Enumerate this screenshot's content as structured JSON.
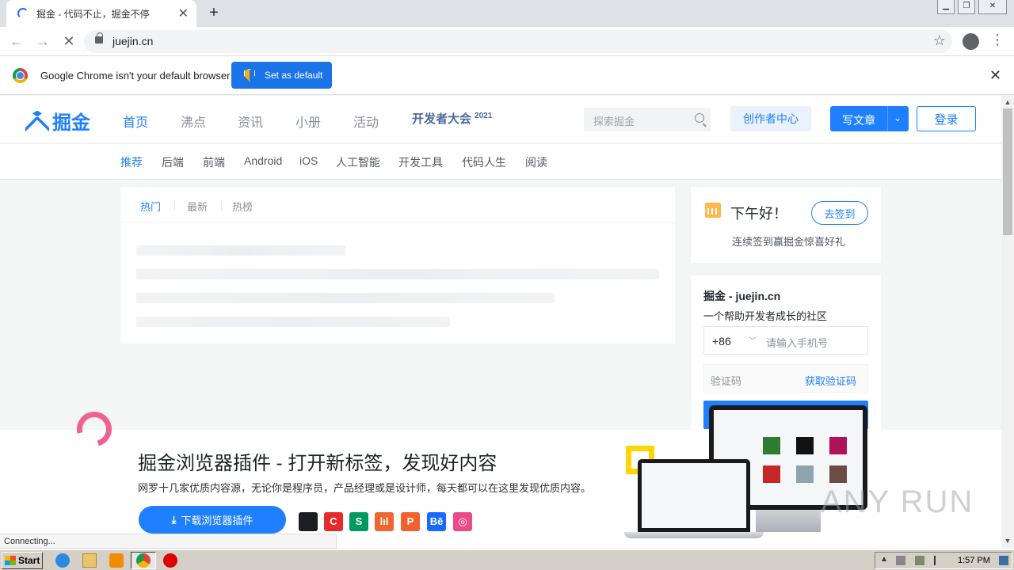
{
  "browser": {
    "tab_title": "掘金 - 代码不止，掘金不停",
    "url": "juejin.cn",
    "infobar_message": "Google Chrome isn't your default browser",
    "set_default_label": "Set as default",
    "status_text": "Connecting..."
  },
  "header": {
    "logo_text": "掘金",
    "nav": [
      "首页",
      "沸点",
      "资讯",
      "小册",
      "活动"
    ],
    "conference_label": "开发者大会",
    "conference_year": "2021",
    "search_placeholder": "探索掘金",
    "creator_label": "创作者中心",
    "write_label": "写文章",
    "login_label": "登录"
  },
  "categories": [
    "推荐",
    "后端",
    "前端",
    "Android",
    "iOS",
    "人工智能",
    "开发工具",
    "代码人生",
    "阅读"
  ],
  "feed_tabs": [
    "热门",
    "最新",
    "热榜"
  ],
  "sidebar": {
    "greeting": "下午好！",
    "checkin_label": "去签到",
    "checkin_sub": "连续签到赢掘金惊喜好礼",
    "login_title": "掘金 - juejin.cn",
    "login_sub": "一个帮助开发者成长的社区",
    "country_code": "+86",
    "phone_placeholder": "请输入手机号",
    "code_placeholder": "验证码",
    "get_code_label": "获取验证码"
  },
  "promo": {
    "headline": "掘金浏览器插件 - 打开新标签，发现好内容",
    "description": "网罗十几家优质内容源，无论你是程序员，产品经理或是设计师，每天都可以在这里发现优质内容。",
    "download_label": "下载浏览器插件",
    "site_icons": [
      {
        "name": "github",
        "glyph": "",
        "color": "#1b1f23"
      },
      {
        "name": "csdn",
        "glyph": "C",
        "color": "#e52b2b"
      },
      {
        "name": "segmentfault",
        "glyph": "S",
        "color": "#009a61"
      },
      {
        "name": "infoq",
        "glyph": "lıl",
        "color": "#f06630"
      },
      {
        "name": "producthunt",
        "glyph": "P",
        "color": "#f0612f"
      },
      {
        "name": "behance",
        "glyph": "Bē",
        "color": "#1769ff"
      },
      {
        "name": "dribbble",
        "glyph": "◎",
        "color": "#ea4c89"
      }
    ]
  },
  "watermark": "ANY RUN",
  "taskbar": {
    "start_label": "Start",
    "clock": "1:57 PM"
  }
}
